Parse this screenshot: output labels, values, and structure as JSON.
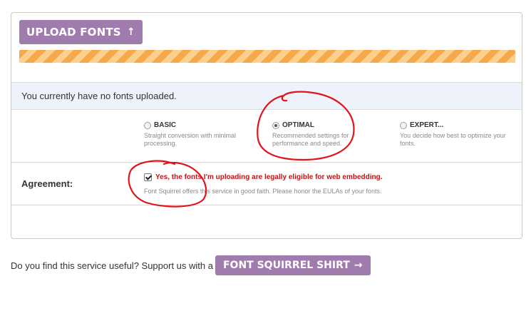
{
  "upload": {
    "button_label": "UPLOAD FONTS",
    "button_icon": "arrow-up-icon"
  },
  "status": {
    "message": "You currently have no fonts uploaded."
  },
  "modes": [
    {
      "label": "BASIC",
      "description": "Straight conversion with minimal processing.",
      "selected": false
    },
    {
      "label": "OPTIMAL",
      "description": "Recommended settings for performance and speed.",
      "selected": true
    },
    {
      "label": "EXPERT...",
      "description": "You decide how best to optimize your fonts.",
      "selected": false
    }
  ],
  "agreement": {
    "label": "Agreement:",
    "checkbox_text": "Yes, the fonts I'm uploading are legally eligible for web embedding.",
    "note": "Font Squirrel offers this service in good faith. Please honor the EULAs of your fonts.",
    "checked": true
  },
  "support": {
    "text": "Do you find this service useful? Support us with a",
    "button_label": "FONT SQUIRREL SHIRT",
    "button_icon": "arrow-right-icon"
  },
  "colors": {
    "button_purple": "#a07cae",
    "progress_orange": "#f5a94a",
    "status_bg": "#eef3fb",
    "warning_red": "#c0141a",
    "annotation_red": "#e0141a"
  }
}
